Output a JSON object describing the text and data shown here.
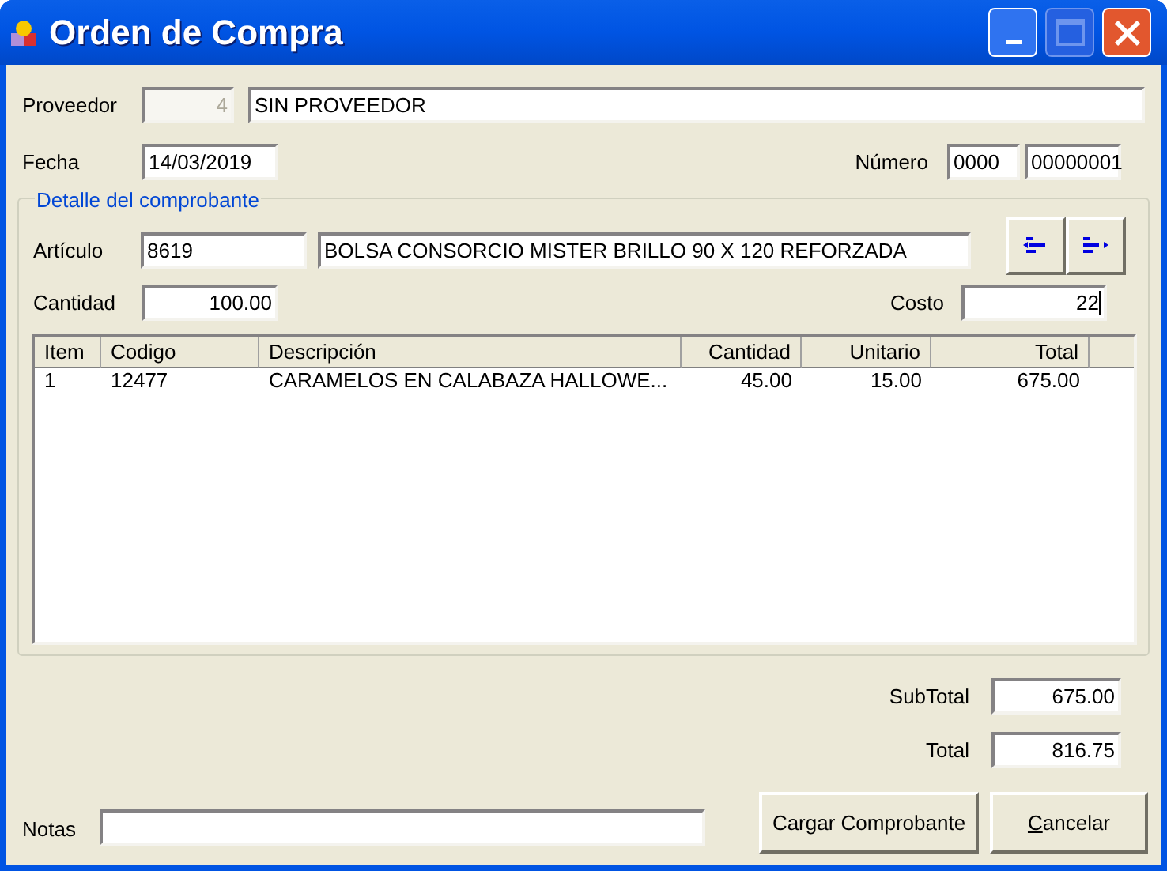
{
  "window": {
    "title": "Orden de Compra",
    "maximize_disabled": true
  },
  "proveedor": {
    "label": "Proveedor",
    "code": {
      "value": "4",
      "disabled": true
    },
    "name": {
      "value": "SIN PROVEEDOR"
    }
  },
  "fecha": {
    "label": "Fecha",
    "value": "14/03/2019"
  },
  "numero": {
    "label": "Número",
    "prefix": "0000",
    "number": "00000001"
  },
  "detalle": {
    "legend": "Detalle del comprobante",
    "articulo": {
      "label": "Artículo",
      "code": "8619",
      "description": "BOLSA CONSORCIO MISTER BRILLO 90 X 120 REFORZADA"
    },
    "cantidad": {
      "label": "Cantidad",
      "value": "100.00"
    },
    "costo": {
      "label": "Costo",
      "value": "22",
      "focused": true
    },
    "table": {
      "columns": [
        "Item",
        "Codigo",
        "Descripción",
        "Cantidad",
        "Unitario",
        "Total"
      ],
      "rows": [
        [
          "1",
          "12477",
          "CARAMELOS EN CALABAZA HALLOWE...",
          "45.00",
          "15.00",
          "675.00"
        ]
      ]
    }
  },
  "subtotal": {
    "label": "SubTotal",
    "value": "675.00"
  },
  "total": {
    "label": "Total",
    "value": "816.75"
  },
  "notas": {
    "label": "Notas"
  },
  "buttons": [
    {
      "label": "Cargar Comprobante",
      "mnemonic": false
    },
    {
      "label": "Cancelar",
      "mnemonic": true
    }
  ]
}
